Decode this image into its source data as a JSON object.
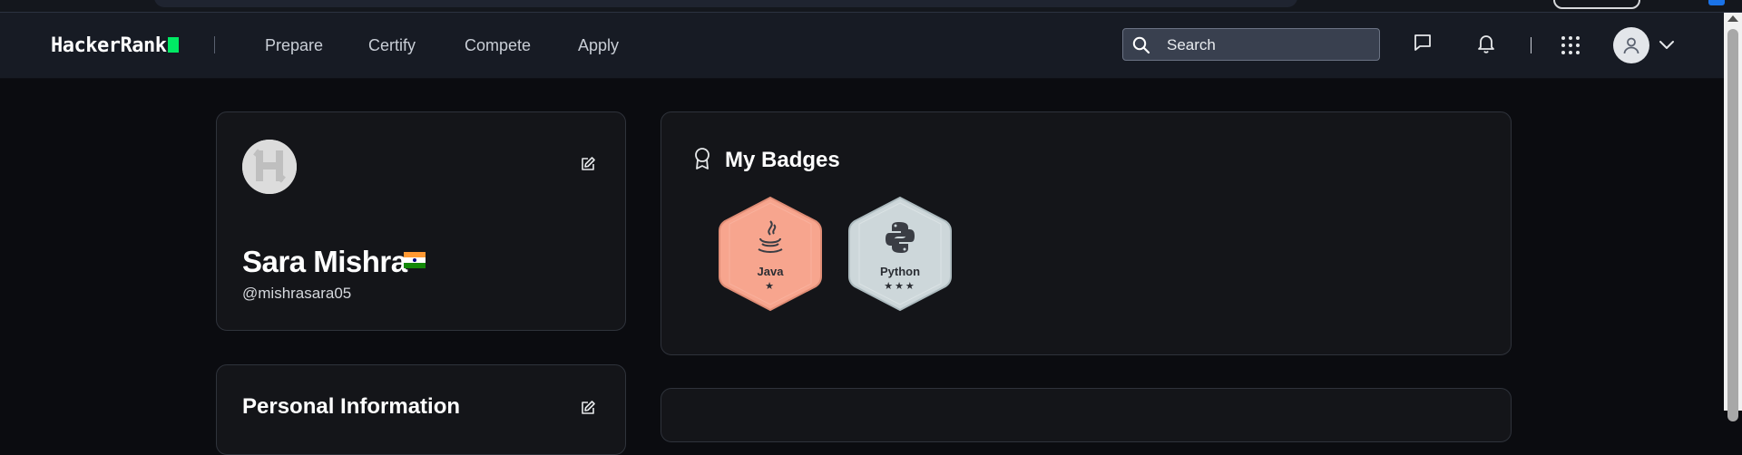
{
  "navbar": {
    "logo_text": "HackerRank",
    "links": [
      "Prepare",
      "Certify",
      "Compete",
      "Apply"
    ],
    "search_placeholder": "Search",
    "icons": [
      "message-icon",
      "bell-icon",
      "apps-grid-icon",
      "user-avatar-icon",
      "chevron-down-icon"
    ]
  },
  "profile": {
    "name": "Sara Mishra",
    "handle": "@mishrasara05",
    "country_flag": "india-flag"
  },
  "personal_info": {
    "title": "Personal Information"
  },
  "badges": {
    "title": "My Badges",
    "items": [
      {
        "name": "Java",
        "stars": "★",
        "color": "#f7a58e"
      },
      {
        "name": "Python",
        "stars": "★★★",
        "color": "#cdd7da"
      }
    ]
  },
  "colors": {
    "brand_green": "#00ea64",
    "background": "#0b0c10",
    "navbar": "#171b24",
    "card": "#141519"
  }
}
